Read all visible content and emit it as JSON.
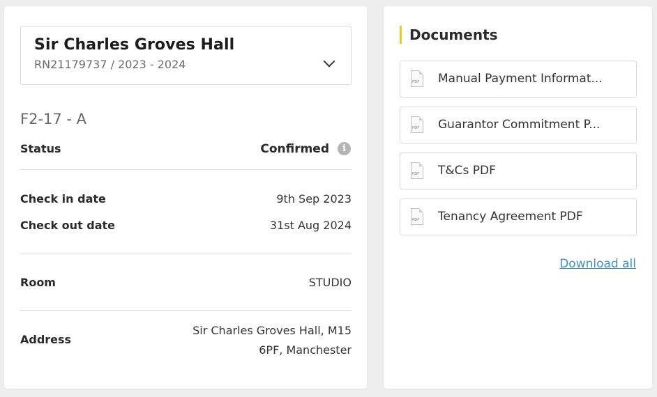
{
  "booking": {
    "property_name": "Sir Charles Groves Hall",
    "reference": "RN21179737 / 2023 - 2024",
    "room_code": "F2-17 - A",
    "status_label": "Status",
    "status_value": "Confirmed",
    "checkin_label": "Check in date",
    "checkin_value": "9th Sep 2023",
    "checkout_label": "Check out date",
    "checkout_value": "31st Aug 2024",
    "room_label": "Room",
    "room_value": "STUDIO",
    "address_label": "Address",
    "address_line1": "Sir Charles Groves Hall, M15",
    "address_line2": "6PF, Manchester",
    "info_icon_glyph": "i"
  },
  "documents": {
    "heading": "Documents",
    "accent_color": "#f3c623",
    "pdf_icon_text": "PDF",
    "items": [
      {
        "label": "Manual Payment Informat..."
      },
      {
        "label": "Guarantor Commitment P..."
      },
      {
        "label": "T&Cs PDF"
      },
      {
        "label": "Tenancy Agreement PDF"
      }
    ],
    "download_all": "Download all",
    "link_color": "#3b8fd8"
  }
}
